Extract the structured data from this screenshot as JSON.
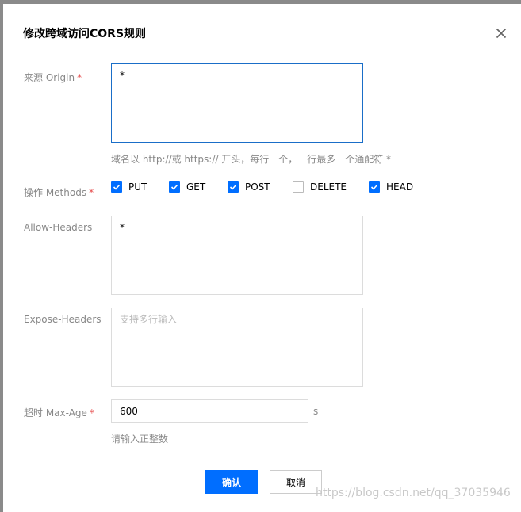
{
  "dialog": {
    "title": "修改跨域访问CORS规则",
    "close_icon": "close-icon"
  },
  "origin": {
    "label": "来源 Origin",
    "value": "*",
    "hint": "域名以 http://或 https:// 开头，每行一个，一行最多一个通配符 *"
  },
  "methods": {
    "label": "操作 Methods",
    "options": [
      {
        "label": "PUT",
        "checked": true
      },
      {
        "label": "GET",
        "checked": true
      },
      {
        "label": "POST",
        "checked": true
      },
      {
        "label": "DELETE",
        "checked": false
      },
      {
        "label": "HEAD",
        "checked": true
      }
    ]
  },
  "allow_headers": {
    "label": "Allow-Headers",
    "value": "*"
  },
  "expose_headers": {
    "label": "Expose-Headers",
    "value": "",
    "placeholder": "支持多行输入"
  },
  "max_age": {
    "label": "超时 Max-Age",
    "value": "600",
    "unit": "s",
    "hint": "请输入正整数"
  },
  "buttons": {
    "confirm": "确认",
    "cancel": "取消"
  },
  "watermark": "https://blog.csdn.net/qq_37035946",
  "colors": {
    "primary": "#006eff",
    "required": "#e54545",
    "focus_border": "#1a6ec8"
  }
}
